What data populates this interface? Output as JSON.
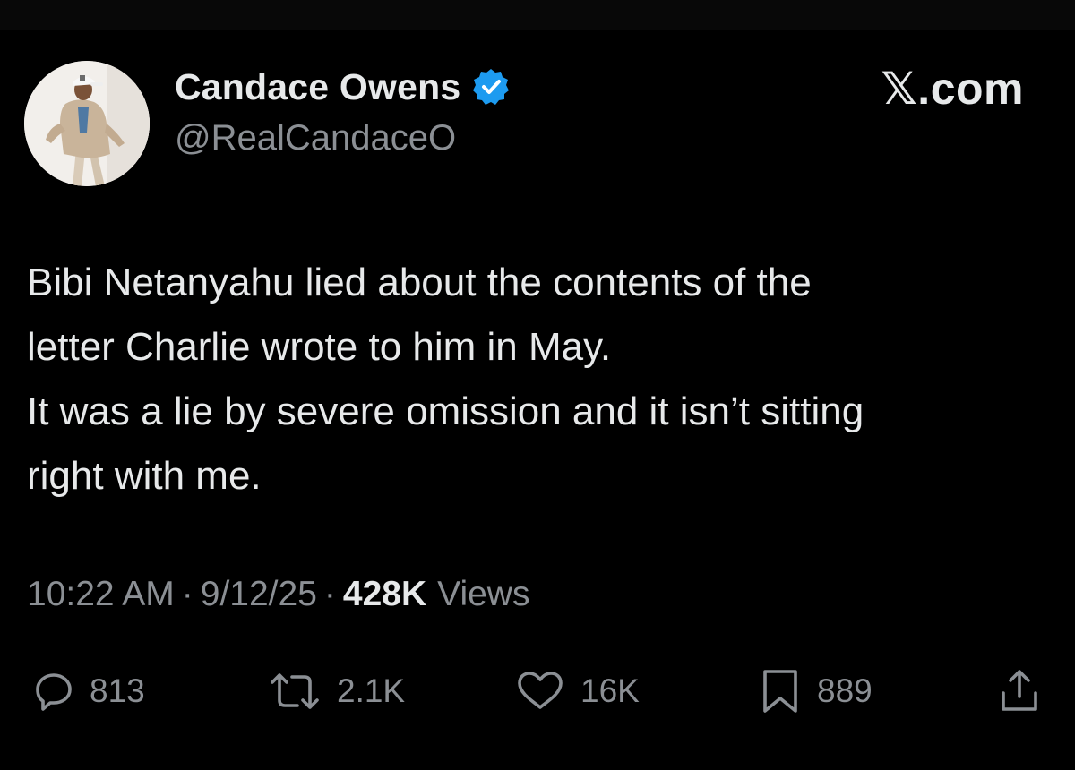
{
  "author": {
    "display_name": "Candace Owens",
    "handle": "@RealCandaceO",
    "verified": true,
    "avatar_icon": "profile-photo"
  },
  "brand": {
    "logo_text": "𝕏.com"
  },
  "tweet": {
    "lines": [
      "Bibi Netanyahu lied about the contents of the",
      "letter Charlie wrote to him in May.",
      "It was a lie by severe omission and it isn’t sitting",
      "right with me."
    ]
  },
  "meta": {
    "time": "10:22 AM",
    "separator": "·",
    "date": "9/12/25",
    "views_count": "428K",
    "views_label": "Views"
  },
  "actions": {
    "reply": {
      "icon": "reply-icon",
      "count": "813"
    },
    "retweet": {
      "icon": "retweet-icon",
      "count": "2.1K"
    },
    "like": {
      "icon": "heart-icon",
      "count": "16K"
    },
    "bookmark": {
      "icon": "bookmark-icon",
      "count": "889"
    },
    "share": {
      "icon": "share-icon"
    }
  },
  "colors": {
    "background": "#000000",
    "text_primary": "#e7e9ea",
    "text_secondary": "#8b8f94",
    "verified_blue": "#1d9bf0"
  }
}
